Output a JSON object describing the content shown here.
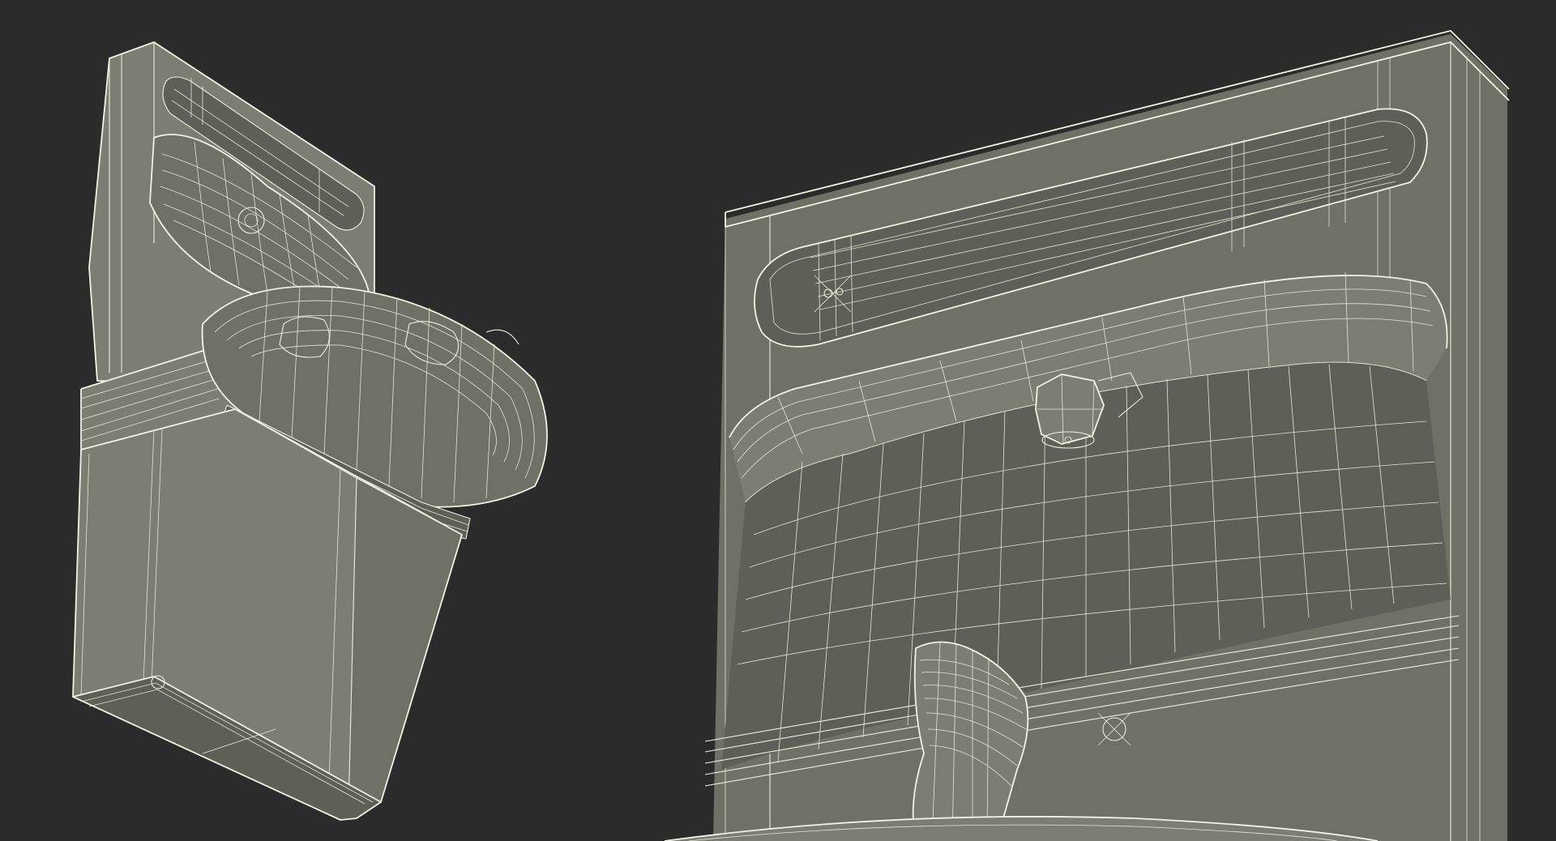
{
  "scene": {
    "background_color": "#2a2b2a",
    "surface_color": "#6f7066",
    "surface_shade": "#5e5f56",
    "surface_light": "#7d7e73",
    "wire_color": "#efeede",
    "views": [
      {
        "name": "drinking-fountain-overview-wireframe"
      },
      {
        "name": "drinking-fountain-basin-closeup-wireframe"
      }
    ]
  }
}
